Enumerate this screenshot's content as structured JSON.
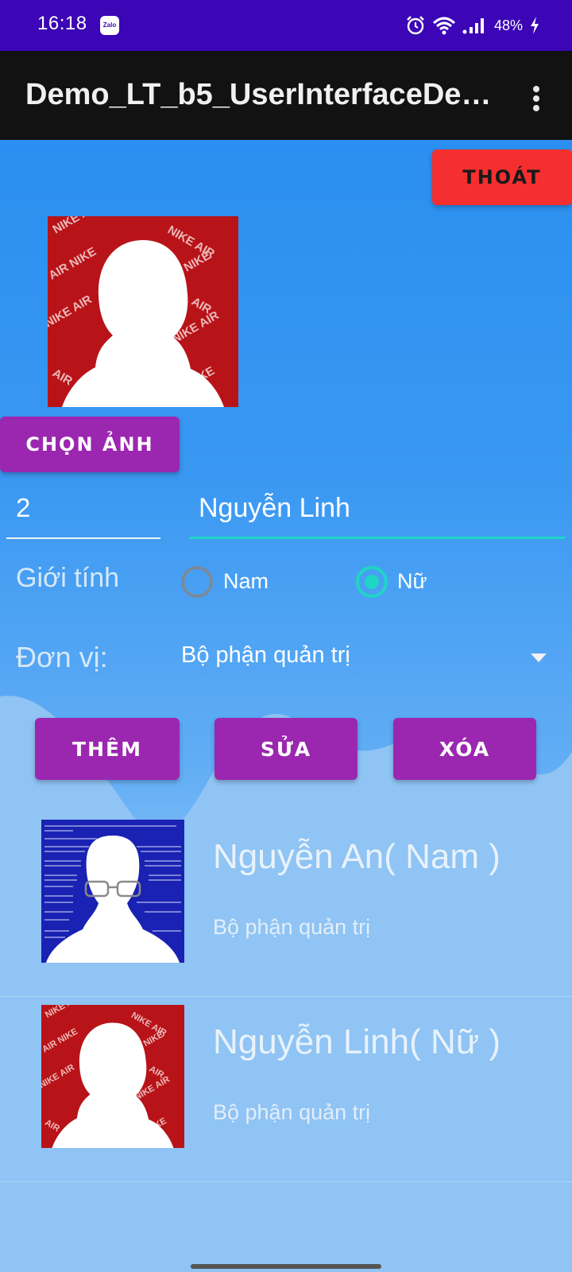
{
  "status_bar": {
    "time": "16:18",
    "app_notification": "Zalo",
    "battery": "48%",
    "icons": [
      "alarm-icon",
      "wifi-icon",
      "signal-icon",
      "battery-charging-icon"
    ]
  },
  "app_bar": {
    "title": "Demo_LT_b5_UserInterfaceDe…",
    "menu_icon": "overflow-menu-icon"
  },
  "form": {
    "exit_label": "THOÁT",
    "choose_photo_label": "CHỌN ẢNH",
    "id_value": "2",
    "name_value": "Nguyễn  Linh",
    "gender_label": "Giới tính",
    "gender_options": [
      "Nam",
      "Nữ"
    ],
    "gender_selected": "Nữ",
    "unit_label": "Đơn vị:",
    "unit_selected": "Bộ phận quản trị",
    "add_label": "THÊM",
    "edit_label": "SỬA",
    "delete_label": "XÓA"
  },
  "list": {
    "items": [
      {
        "name": "Nguyễn  An( Nam )",
        "unit": "Bộ phận quản trị",
        "avatar": "bsod-avatar"
      },
      {
        "name": "Nguyễn  Linh( Nữ )",
        "unit": "Bộ phận quản trị",
        "avatar": "nike-avatar"
      }
    ]
  },
  "colors": {
    "status_bar": "#3c05b6",
    "app_bar": "#121212",
    "exit_button": "#f52f2f",
    "primary_button": "#9b27b0",
    "accent": "#1fd5c4",
    "background": "#2a8ff0"
  }
}
